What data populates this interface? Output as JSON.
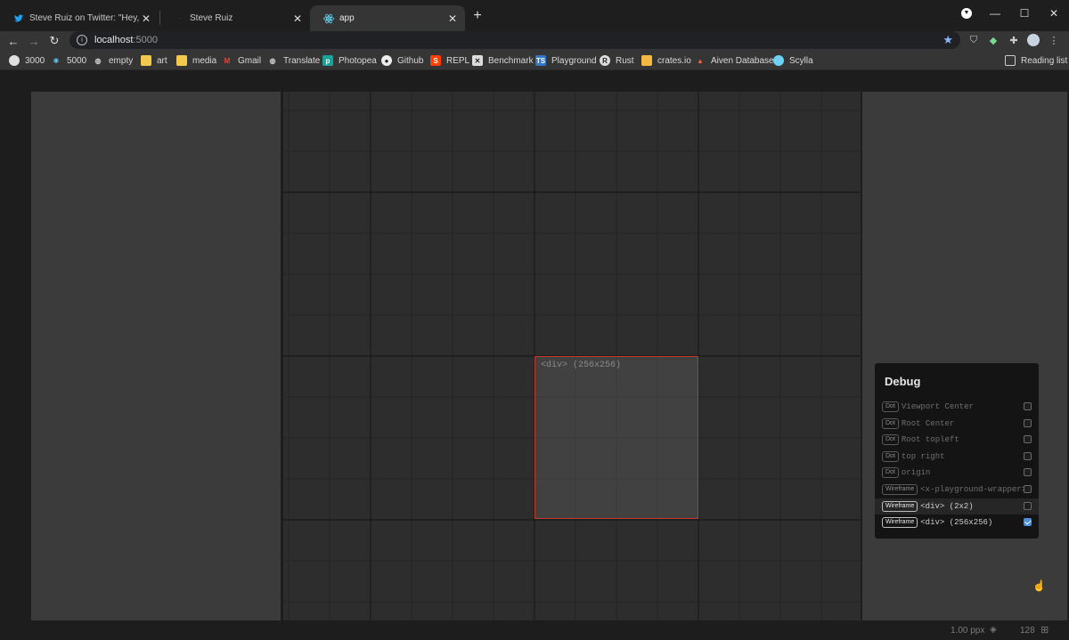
{
  "browser": {
    "tabs": [
      {
        "title": "Steve Ruiz on Twitter: \"Hey, here",
        "favicon": "twitter-icon"
      },
      {
        "title": "Steve Ruiz",
        "favicon": "blank-icon"
      },
      {
        "title": "app",
        "favicon": "react-icon",
        "active": true
      }
    ],
    "new_tab_label": "+",
    "address": {
      "host": "localhost",
      "port": ":5000"
    },
    "bookmarks": [
      {
        "label": "3000",
        "icon": "db-icon"
      },
      {
        "label": "5000",
        "icon": "react-icon"
      },
      {
        "label": "empty",
        "icon": "globe-icon"
      },
      {
        "label": "art",
        "icon": "folder-icon"
      },
      {
        "label": "media",
        "icon": "folder-icon"
      },
      {
        "label": "Gmail",
        "icon": "gmail-icon"
      },
      {
        "label": "Translate",
        "icon": "globe-icon"
      },
      {
        "label": "Photopea",
        "icon": "photopea-icon"
      },
      {
        "label": "Github",
        "icon": "github-icon"
      },
      {
        "label": "REPL",
        "icon": "svelte-icon"
      },
      {
        "label": "Benchmark",
        "icon": "benchmark-icon"
      },
      {
        "label": "Playground",
        "icon": "ts-icon"
      },
      {
        "label": "Rust",
        "icon": "rust-icon"
      },
      {
        "label": "crates.io",
        "icon": "crates-icon"
      },
      {
        "label": "Aiven Database",
        "icon": "aiven-icon"
      },
      {
        "label": "Scylla",
        "icon": "scylla-icon"
      }
    ],
    "reading_list": "Reading list"
  },
  "canvas": {
    "selection_label": "<div> (256x256)",
    "selection_color": "#c0392b"
  },
  "debug": {
    "title": "Debug",
    "rows": [
      {
        "tag": "Dot",
        "label": "Viewport Center",
        "checked": false,
        "active": false
      },
      {
        "tag": "Dot",
        "label": "Root Center",
        "checked": false,
        "active": false
      },
      {
        "tag": "Dot",
        "label": "Root topleft",
        "checked": false,
        "active": false
      },
      {
        "tag": "Dot",
        "label": "top right",
        "checked": false,
        "active": false
      },
      {
        "tag": "Dot",
        "label": "origin",
        "checked": false,
        "active": false
      },
      {
        "tag": "Wireframe",
        "label": "<x-playground-wrapper>",
        "checked": false,
        "active": false
      },
      {
        "tag": "Wireframe",
        "label": "<div> (2x2)",
        "checked": false,
        "active": true
      },
      {
        "tag": "Wireframe",
        "label": "<div> (256x256)",
        "checked": true,
        "active": true
      }
    ]
  },
  "status": {
    "zoom": "1.00 ppx",
    "grid": "128"
  }
}
